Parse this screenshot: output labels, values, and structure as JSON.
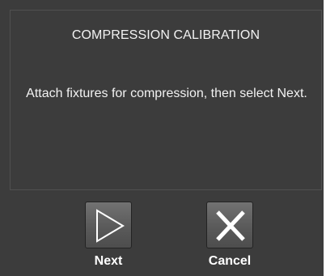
{
  "dialog": {
    "title": "COMPRESSION CALIBRATION",
    "message": "Attach fixtures for compression, then select Next."
  },
  "buttons": {
    "next": {
      "label": "Next",
      "icon": "play-triangle-icon"
    },
    "cancel": {
      "label": "Cancel",
      "icon": "close-x-icon"
    }
  },
  "colors": {
    "background": "#3c3c3c",
    "panel_border": "#505050",
    "text": "#f2f2f2",
    "button_face": "#5f5f5f"
  }
}
